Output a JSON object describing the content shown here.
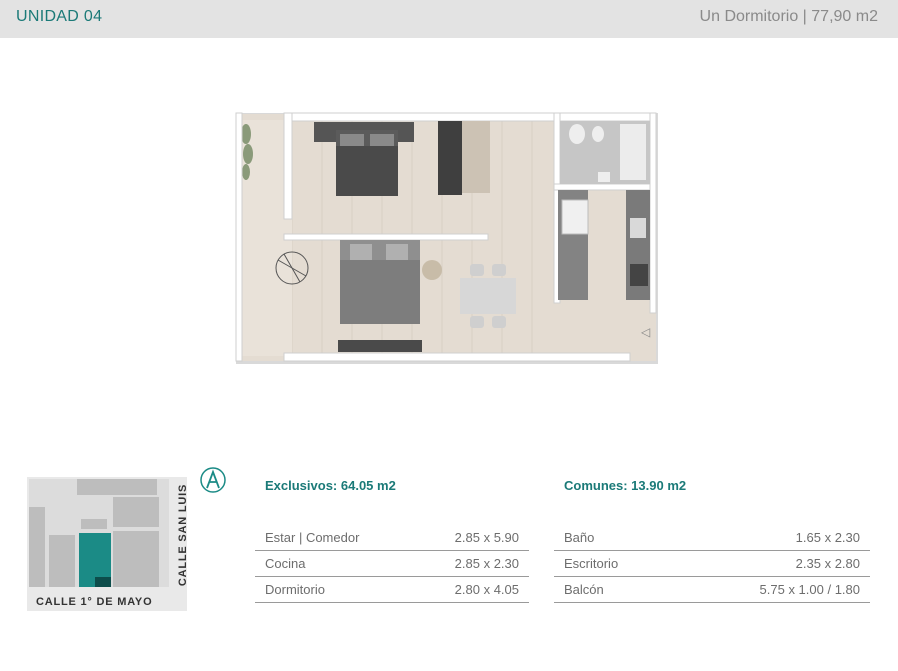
{
  "header": {
    "unit_title": "UNIDAD 04",
    "unit_subtitle": "Un Dormitorio | 77,90 m2"
  },
  "keymap": {
    "street_side": "CALLE SAN LUIS",
    "street_bottom": "CALLE 1° DE MAYO",
    "highlight_color": "#1b8b86"
  },
  "colors": {
    "accent": "#1b7a78",
    "header_bg": "#e3e3e3"
  },
  "exclusivos": {
    "title": "Exclusivos: 64.05 m2",
    "rooms": [
      {
        "name": "Estar | Comedor",
        "size": "2.85 x 5.90"
      },
      {
        "name": "Cocina",
        "size": "2.85 x 2.30"
      },
      {
        "name": "Dormitorio",
        "size": "2.80 x 4.05"
      }
    ]
  },
  "comunes": {
    "title": "Comunes: 13.90 m2",
    "rooms": [
      {
        "name": "Baño",
        "size": "1.65 x 2.30"
      },
      {
        "name": "Escritorio",
        "size": "2.35 x 2.80"
      },
      {
        "name": "Balcón",
        "size": "5.75 x 1.00 / 1.80"
      }
    ]
  }
}
